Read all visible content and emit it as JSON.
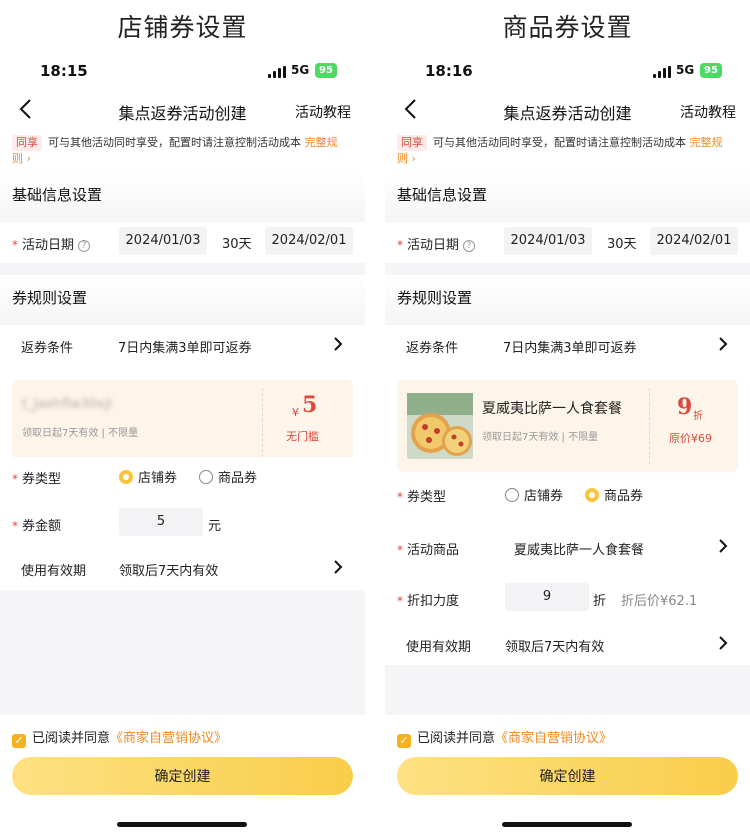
{
  "captions": {
    "left": "店铺券设置",
    "right": "商品券设置"
  },
  "left": {
    "status": {
      "time": "18:15",
      "network": "5G",
      "battery": "95"
    },
    "nav": {
      "title": "集点返券活动创建",
      "tutorial": "活动教程"
    },
    "notice": {
      "tag": "同享",
      "text": "可与其他活动同时享受，配置时请注意控制活动成本",
      "link": "完整规",
      "link2": "则 ›"
    },
    "basic_section": "基础信息设置",
    "activity_date": {
      "label": "活动日期",
      "help": "?",
      "start": "2024/01/03",
      "days": "30天",
      "end": "2024/02/01"
    },
    "rule_section": "券规则设置",
    "return_condition": {
      "label": "返券条件",
      "value": "7日内集满3单即可返券"
    },
    "coupon_card": {
      "name": "t_Jaehflw30xjl",
      "sub": "领取日起7天有效 | 不限量",
      "currency": "¥",
      "amount": "5",
      "threshold": "无门槛"
    },
    "coupon_type": {
      "label": "券类型",
      "opt1": "店铺券",
      "opt2": "商品券",
      "selected": "店铺券"
    },
    "coupon_amount": {
      "label": "券金额",
      "value": "5",
      "unit": "元"
    },
    "validity": {
      "label": "使用有效期",
      "value": "领取后7天内有效"
    },
    "agree": {
      "text": "已阅读并同意",
      "link": "《商家自营销协议》"
    },
    "confirm": "确定创建"
  },
  "right": {
    "status": {
      "time": "18:16",
      "network": "5G",
      "battery": "95"
    },
    "nav": {
      "title": "集点返券活动创建",
      "tutorial": "活动教程"
    },
    "notice": {
      "tag": "同享",
      "text": "可与其他活动同时享受，配置时请注意控制活动成本",
      "link": "完整规",
      "link2": "则 ›"
    },
    "basic_section": "基础信息设置",
    "activity_date": {
      "label": "活动日期",
      "help": "?",
      "start": "2024/01/03",
      "days": "30天",
      "end": "2024/02/01"
    },
    "rule_section": "券规则设置",
    "return_condition": {
      "label": "返券条件",
      "value": "7日内集满3单即可返券"
    },
    "coupon_card": {
      "name": "夏威夷比萨一人食套餐",
      "sub": "领取日起7天有效 | 不限量",
      "discount": "9",
      "discount_unit": "折",
      "orig_price": "原价¥69"
    },
    "coupon_type": {
      "label": "券类型",
      "opt1": "店铺券",
      "opt2": "商品券",
      "selected": "商品券"
    },
    "activity_product": {
      "label": "活动商品",
      "value": "夏威夷比萨一人食套餐"
    },
    "discount": {
      "label": "折扣力度",
      "value": "9",
      "unit": "折",
      "after": "折后价¥62.1"
    },
    "validity": {
      "label": "使用有效期",
      "value": "领取后7天内有效"
    },
    "agree": {
      "text": "已阅读并同意",
      "link": "《商家自营销协议》"
    },
    "confirm": "确定创建"
  },
  "colors": {
    "accent": "#f9cd4a",
    "price_red": "#e0473c",
    "link_orange": "#f08a24"
  }
}
